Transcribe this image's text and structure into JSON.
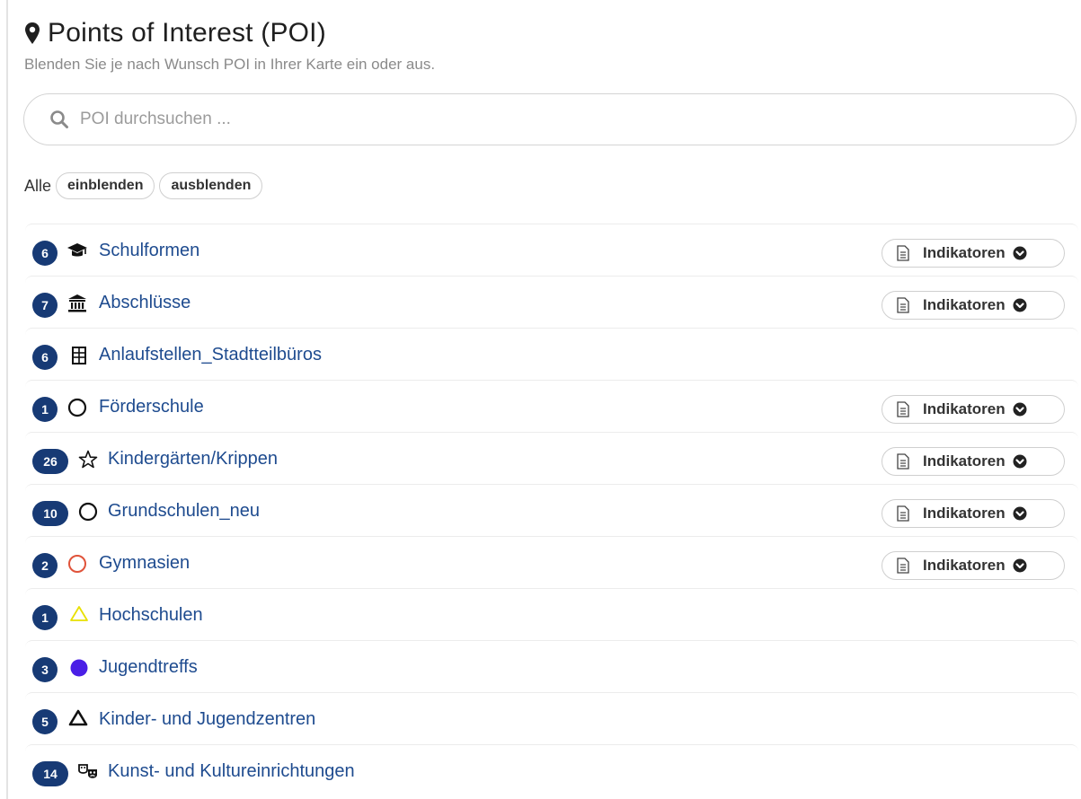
{
  "header": {
    "title": "Points of Interest (POI)",
    "subtitle": "Blenden Sie je nach Wunsch POI in Ihrer Karte ein oder aus."
  },
  "search": {
    "placeholder": "POI durchsuchen ...",
    "value": ""
  },
  "toggle_all": {
    "label": "Alle",
    "show_label": "einblenden",
    "hide_label": "ausblenden"
  },
  "indicator_label": "Indikatoren",
  "colors": {
    "badge": "#173a75",
    "link": "#1e4b8f",
    "gymnasien_icon": "#e0533a",
    "hochschulen_icon": "#e8e000",
    "jugendtreffs_icon": "#4a1fe6"
  },
  "pois": [
    {
      "count": "6",
      "icon": "graduation-cap-icon",
      "name": "Schulformen",
      "has_indicators": true
    },
    {
      "count": "7",
      "icon": "institution-icon",
      "name": "Abschlüsse",
      "has_indicators": true
    },
    {
      "count": "6",
      "icon": "building-icon",
      "name": "Anlaufstellen_Stadtteilbüros",
      "has_indicators": false
    },
    {
      "count": "1",
      "icon": "circle-outline-icon",
      "name": "Förderschule",
      "has_indicators": true
    },
    {
      "count": "26",
      "icon": "star-outline-icon",
      "name": "Kindergärten/Krippen",
      "has_indicators": true
    },
    {
      "count": "10",
      "icon": "circle-outline-icon",
      "name": "Grundschulen_neu",
      "has_indicators": true
    },
    {
      "count": "2",
      "icon": "circle-outline-red-icon",
      "name": "Gymnasien",
      "has_indicators": true
    },
    {
      "count": "1",
      "icon": "triangle-outline-yellow-icon",
      "name": "Hochschulen",
      "has_indicators": false
    },
    {
      "count": "3",
      "icon": "filled-circle-purple-icon",
      "name": "Jugendtreffs",
      "has_indicators": false
    },
    {
      "count": "5",
      "icon": "triangle-outline-icon",
      "name": "Kinder- und Jugendzentren",
      "has_indicators": false
    },
    {
      "count": "14",
      "icon": "masks-icon",
      "name": "Kunst- und Kultureinrichtungen",
      "has_indicators": false
    }
  ]
}
